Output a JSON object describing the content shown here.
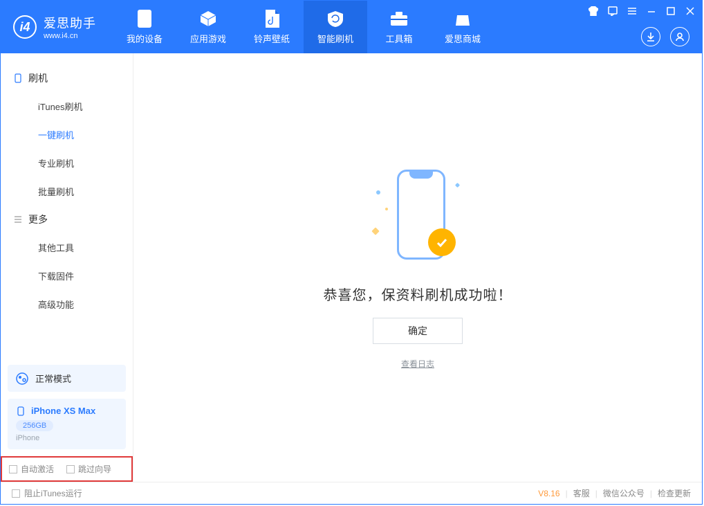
{
  "app": {
    "name_zh": "爱思助手",
    "name_en": "www.i4.cn"
  },
  "header_tabs": [
    {
      "label": "我的设备"
    },
    {
      "label": "应用游戏"
    },
    {
      "label": "铃声壁纸"
    },
    {
      "label": "智能刷机"
    },
    {
      "label": "工具箱"
    },
    {
      "label": "爱思商城"
    }
  ],
  "sidebar": {
    "sec_flash": "刷机",
    "items_flash": [
      "iTunes刷机",
      "一键刷机",
      "专业刷机",
      "批量刷机"
    ],
    "sec_more": "更多",
    "items_more": [
      "其他工具",
      "下载固件",
      "高级功能"
    ]
  },
  "mode": {
    "label": "正常模式"
  },
  "device": {
    "name": "iPhone XS Max",
    "capacity": "256GB",
    "sub": "iPhone"
  },
  "options": {
    "auto_activate": "自动激活",
    "skip_guide": "跳过向导"
  },
  "main": {
    "success_msg": "恭喜您，保资料刷机成功啦！",
    "ok_label": "确定",
    "view_log": "查看日志"
  },
  "footer": {
    "block_itunes": "阻止iTunes运行",
    "version": "V8.16",
    "support": "客服",
    "wechat": "微信公众号",
    "check_update": "检查更新"
  }
}
